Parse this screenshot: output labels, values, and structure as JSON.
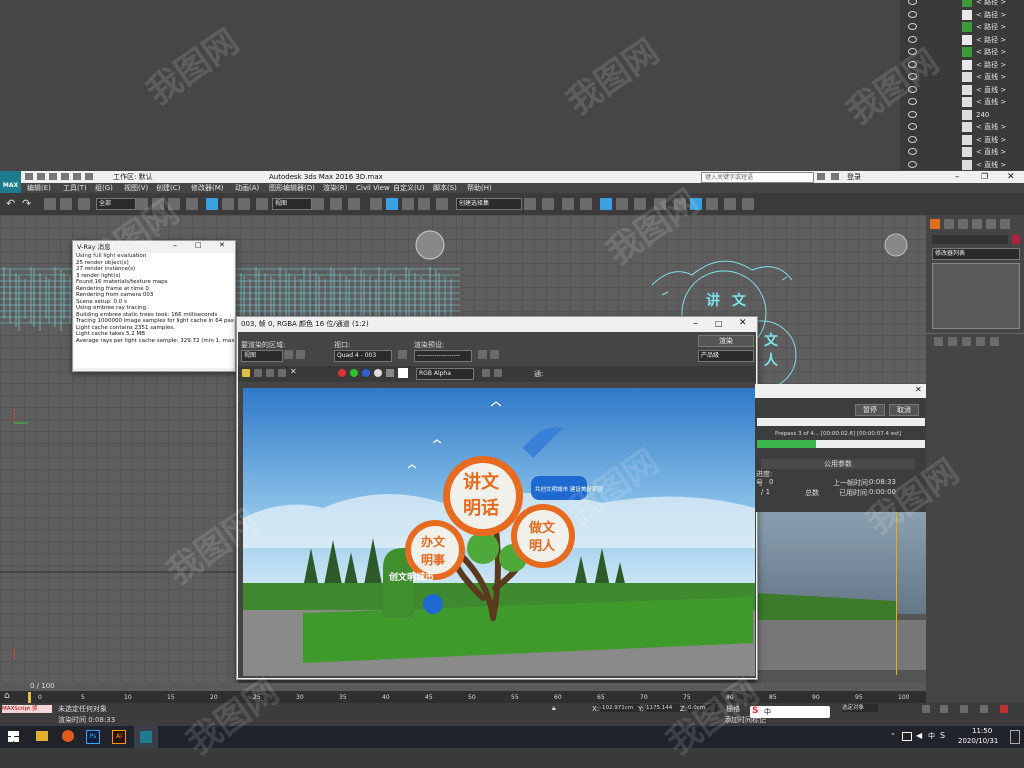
{
  "scene_explorer": {
    "rows": [
      {
        "label": "< 路径 >"
      },
      {
        "label": "< 路径 >"
      },
      {
        "label": "< 路径 >"
      },
      {
        "label": "< 路径 >"
      },
      {
        "label": "< 路径 >"
      },
      {
        "label": "< 路径 >"
      },
      {
        "label": "< 直线 >"
      },
      {
        "label": "< 直线 >"
      },
      {
        "label": "< 直线 >"
      },
      {
        "label": "240"
      },
      {
        "label": "< 直线 >"
      },
      {
        "label": "< 直线 >"
      },
      {
        "label": "< 直线 >"
      },
      {
        "label": "< 直线 >"
      }
    ]
  },
  "app": {
    "logo": "MAX",
    "workspace": "工作区: 默认",
    "title": "Autodesk 3ds Max 2016     3D.max",
    "search_placeholder": "键入关键字或短语",
    "login": "登录"
  },
  "menu": [
    "编辑(E)",
    "工具(T)",
    "组(G)",
    "视图(V)",
    "创建(C)",
    "修改器(M)",
    "动画(A)",
    "图形编辑器(D)",
    "渲染(R)",
    "Civil View",
    "自定义(U)",
    "脚本(S)",
    "帮助(H)"
  ],
  "toolbar": {
    "filter_select": "全部",
    "view_select": "视图",
    "named_set": "创建选择集"
  },
  "vray_log": {
    "title": "V-Ray 消息",
    "lines": [
      "Using full light evaluation",
      "25 render object(s)",
      "27 render instance(s)",
      "3 render light(s)",
      "Found 16 materials/texture maps",
      "Rendering frame at time 0",
      "Rendering from camera 003",
      "Scene setup: 0.0 s",
      "Using embree ray tracing.",
      "Building embree static trees took: 166 milliseconds",
      "Tracing 1000000 image samples for light cache in 64 passes",
      "Light cache contains 2351 samples.",
      "Light cache takes 5.2 MB",
      "Average rays per light cache sample: 329.72 (min 1, max 28"
    ]
  },
  "frame_buffer": {
    "title": "003, 帧 0, RGBA 颜色 16 位/通道 (1:2)",
    "area_label": "要渲染的区域:",
    "area_value": "视图",
    "viewport_label": "视口:",
    "viewport_value": "Quad 4 - 003",
    "preset_label": "渲染预设:",
    "preset_value": "--------------------",
    "render_button": "渲染",
    "product_value": "产品级",
    "channel_value": "RGB Alpha",
    "extra_label": "通:"
  },
  "sculpture_text": {
    "circle_big": "讲文明话",
    "circle_left": "办文明事",
    "circle_right": "做文明人",
    "banner": "共创文明城市 建设美好家园",
    "sign": "创文明城市"
  },
  "progress": {
    "pause_button": "暂停",
    "cancel_button": "取消",
    "prepass_text": "Prepass 3 of 4... [00:00:02.6] [00:00:07.4 est]",
    "prepass_fraction": 0.35,
    "section_title": "公用参数",
    "sub_label": "进度:",
    "label_number": "号",
    "value_number": "0",
    "value_slash": "/ 1",
    "label_total": "总数",
    "label_last_time": "上一帧时间:",
    "value_last_time": "0:08:33",
    "label_elapsed": "已用时间:",
    "value_elapsed": "0:00:00"
  },
  "cmd_panel": {
    "modifier_list": "修改器列表"
  },
  "timeline": {
    "frame_counter": "0 / 100",
    "ticks": [
      "0",
      "5",
      "10",
      "15",
      "20",
      "25",
      "30",
      "35",
      "40",
      "45",
      "50",
      "55",
      "60",
      "65",
      "70",
      "75",
      "80",
      "85",
      "90",
      "95",
      "100"
    ]
  },
  "status": {
    "maxscript": "MAXScript 侦",
    "selection_text": "未选定任何对象",
    "render_time": "渲染时间 0:08:33",
    "coord_x_label": "X:",
    "coord_x": "-102.971cm",
    "coord_y_label": "Y:",
    "coord_y": "1175.144",
    "coord_z_label": "Z:",
    "coord_z": "0.0cm",
    "grid_label": "栅格",
    "add_time_tag": "添加时间标记",
    "selected_obj": "选定对象"
  },
  "taskbar": {
    "clock_time": "11:50",
    "clock_date": "2020/10/31",
    "ime": "中"
  },
  "watermark": "我图网",
  "colors": {
    "viewport_wire": "#7ee0e8",
    "frame_tab_orange": "#ff7a1a",
    "accent_blue": "#3aa0e0",
    "progress_green": "#3ab54a"
  }
}
